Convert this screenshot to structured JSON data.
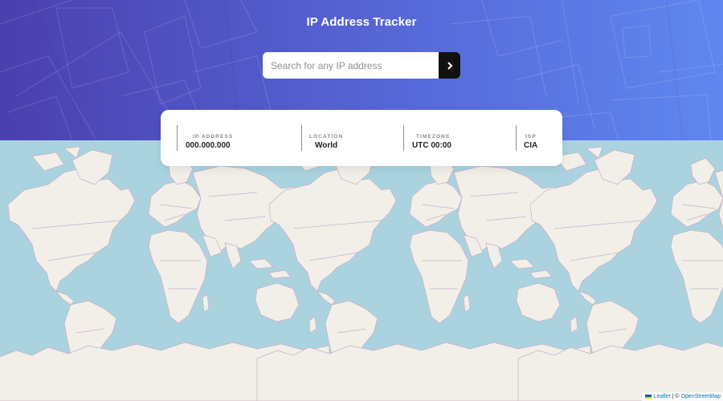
{
  "app": {
    "title": "IP Address Tracker"
  },
  "search": {
    "placeholder": "Search for any IP address",
    "value": "",
    "button_icon": "chevron-right-icon"
  },
  "info": {
    "ip": {
      "label": "IP ADDRESS",
      "value": "000.000.000"
    },
    "location": {
      "label": "LOCATION",
      "value": "World"
    },
    "timezone": {
      "label": "TIMEZONE",
      "value": "UTC 00:00"
    },
    "isp": {
      "label": "ISP",
      "value": "CIA"
    }
  },
  "map": {
    "attribution": {
      "leaflet": "Leaflet",
      "separator": "|",
      "copyright": "©",
      "osm": "OpenStreetMap"
    }
  },
  "colors": {
    "header_gradient_start": "#4b3fae",
    "header_gradient_end": "#5f87ef",
    "search_button": "#111111",
    "map_water": "#aad3df",
    "map_land": "#f2efe9",
    "map_border": "#c8aec8",
    "attribution_link": "#0078a8"
  }
}
